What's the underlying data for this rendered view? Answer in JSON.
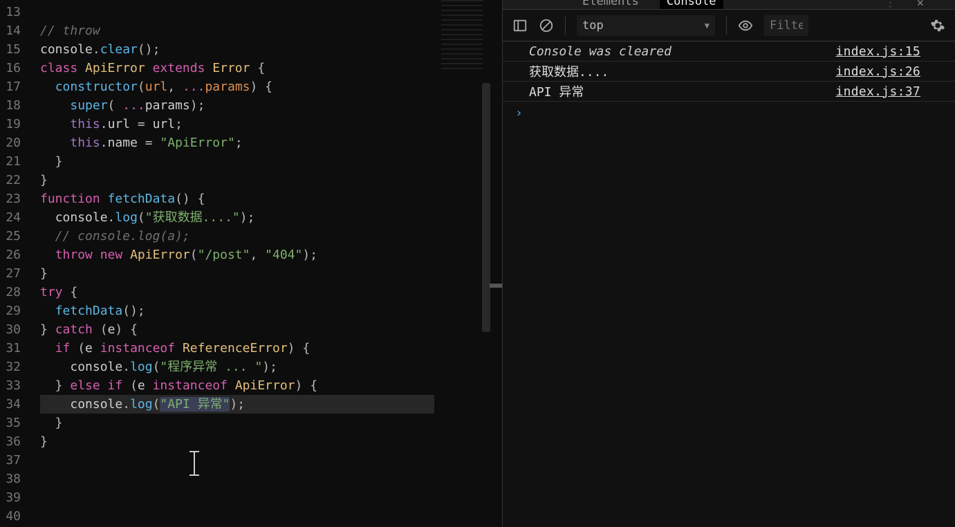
{
  "editor": {
    "first_line_number": 13,
    "lines": [
      {
        "n": 13,
        "tokens": [
          {
            "t": "  ",
            "c": "op"
          }
        ]
      },
      {
        "n": 14,
        "tokens": [
          {
            "t": "// throw",
            "c": "cm"
          }
        ]
      },
      {
        "n": 15,
        "tokens": [
          {
            "t": "console",
            "c": "ident"
          },
          {
            "t": ".",
            "c": "op"
          },
          {
            "t": "clear",
            "c": "fn"
          },
          {
            "t": "();",
            "c": "punc"
          }
        ]
      },
      {
        "n": 16,
        "tokens": [
          {
            "t": "",
            "c": "op"
          }
        ]
      },
      {
        "n": 17,
        "tokens": [
          {
            "t": "class ",
            "c": "kw"
          },
          {
            "t": "ApiError ",
            "c": "cls"
          },
          {
            "t": "extends ",
            "c": "kw"
          },
          {
            "t": "Error ",
            "c": "cls"
          },
          {
            "t": "{",
            "c": "punc"
          }
        ]
      },
      {
        "n": 18,
        "tokens": [
          {
            "t": "  ",
            "c": "op"
          },
          {
            "t": "constructor",
            "c": "fn"
          },
          {
            "t": "(",
            "c": "punc"
          },
          {
            "t": "url",
            "c": "prm"
          },
          {
            "t": ", ",
            "c": "punc"
          },
          {
            "t": "...",
            "c": "kw"
          },
          {
            "t": "params",
            "c": "prm"
          },
          {
            "t": ") {",
            "c": "punc"
          }
        ]
      },
      {
        "n": 19,
        "tokens": [
          {
            "t": "    ",
            "c": "op"
          },
          {
            "t": "super",
            "c": "fn"
          },
          {
            "t": "( ",
            "c": "punc"
          },
          {
            "t": "...",
            "c": "kw"
          },
          {
            "t": "params",
            "c": "ident"
          },
          {
            "t": ");",
            "c": "punc"
          }
        ]
      },
      {
        "n": 20,
        "tokens": [
          {
            "t": "    ",
            "c": "op"
          },
          {
            "t": "this",
            "c": "this"
          },
          {
            "t": ".",
            "c": "op"
          },
          {
            "t": "url",
            "c": "ident"
          },
          {
            "t": " = ",
            "c": "op"
          },
          {
            "t": "url",
            "c": "ident"
          },
          {
            "t": ";",
            "c": "punc"
          }
        ]
      },
      {
        "n": 21,
        "tokens": [
          {
            "t": "    ",
            "c": "op"
          },
          {
            "t": "this",
            "c": "this"
          },
          {
            "t": ".",
            "c": "op"
          },
          {
            "t": "name",
            "c": "ident"
          },
          {
            "t": " = ",
            "c": "op"
          },
          {
            "t": "\"ApiError\"",
            "c": "str"
          },
          {
            "t": ";",
            "c": "punc"
          }
        ]
      },
      {
        "n": 22,
        "tokens": [
          {
            "t": "  }",
            "c": "punc"
          }
        ]
      },
      {
        "n": 23,
        "tokens": [
          {
            "t": "}",
            "c": "punc"
          }
        ]
      },
      {
        "n": 24,
        "tokens": [
          {
            "t": "",
            "c": "op"
          }
        ]
      },
      {
        "n": 25,
        "tokens": [
          {
            "t": "function ",
            "c": "kw"
          },
          {
            "t": "fetchData",
            "c": "fn"
          },
          {
            "t": "() {",
            "c": "punc"
          }
        ]
      },
      {
        "n": 26,
        "tokens": [
          {
            "t": "  ",
            "c": "op"
          },
          {
            "t": "console",
            "c": "ident"
          },
          {
            "t": ".",
            "c": "op"
          },
          {
            "t": "log",
            "c": "fn"
          },
          {
            "t": "(",
            "c": "punc"
          },
          {
            "t": "\"获取数据....\"",
            "c": "str"
          },
          {
            "t": ");",
            "c": "punc"
          }
        ]
      },
      {
        "n": 27,
        "tokens": [
          {
            "t": "  ",
            "c": "op"
          },
          {
            "t": "// console.log(a);",
            "c": "cm"
          }
        ]
      },
      {
        "n": 28,
        "tokens": [
          {
            "t": "  ",
            "c": "op"
          },
          {
            "t": "throw ",
            "c": "kw"
          },
          {
            "t": "new ",
            "c": "kw"
          },
          {
            "t": "ApiError",
            "c": "cls"
          },
          {
            "t": "(",
            "c": "punc"
          },
          {
            "t": "\"/post\"",
            "c": "str"
          },
          {
            "t": ", ",
            "c": "punc"
          },
          {
            "t": "\"404\"",
            "c": "str"
          },
          {
            "t": ");",
            "c": "punc"
          }
        ]
      },
      {
        "n": 29,
        "tokens": [
          {
            "t": "}",
            "c": "punc"
          }
        ]
      },
      {
        "n": 30,
        "tokens": [
          {
            "t": "",
            "c": "op"
          }
        ]
      },
      {
        "n": 31,
        "tokens": [
          {
            "t": "try ",
            "c": "kw"
          },
          {
            "t": "{",
            "c": "punc"
          }
        ]
      },
      {
        "n": 32,
        "tokens": [
          {
            "t": "  ",
            "c": "op"
          },
          {
            "t": "fetchData",
            "c": "fn"
          },
          {
            "t": "();",
            "c": "punc"
          }
        ]
      },
      {
        "n": 33,
        "tokens": [
          {
            "t": "} ",
            "c": "punc"
          },
          {
            "t": "catch ",
            "c": "kw"
          },
          {
            "t": "(",
            "c": "punc"
          },
          {
            "t": "e",
            "c": "ident"
          },
          {
            "t": ") {",
            "c": "punc"
          }
        ]
      },
      {
        "n": 34,
        "tokens": [
          {
            "t": "  ",
            "c": "op"
          },
          {
            "t": "if ",
            "c": "kw"
          },
          {
            "t": "(",
            "c": "punc"
          },
          {
            "t": "e ",
            "c": "ident"
          },
          {
            "t": "instanceof ",
            "c": "kw"
          },
          {
            "t": "ReferenceError",
            "c": "cls"
          },
          {
            "t": ") {",
            "c": "punc"
          }
        ]
      },
      {
        "n": 35,
        "tokens": [
          {
            "t": "    ",
            "c": "op"
          },
          {
            "t": "console",
            "c": "ident"
          },
          {
            "t": ".",
            "c": "op"
          },
          {
            "t": "log",
            "c": "fn"
          },
          {
            "t": "(",
            "c": "punc"
          },
          {
            "t": "\"程序异常 ... \"",
            "c": "str"
          },
          {
            "t": ");",
            "c": "punc"
          }
        ]
      },
      {
        "n": 36,
        "tokens": [
          {
            "t": "  } ",
            "c": "punc"
          },
          {
            "t": "else ",
            "c": "kw"
          },
          {
            "t": "if ",
            "c": "kw"
          },
          {
            "t": "(",
            "c": "punc"
          },
          {
            "t": "e ",
            "c": "ident"
          },
          {
            "t": "instanceof ",
            "c": "kw"
          },
          {
            "t": "ApiError",
            "c": "cls"
          },
          {
            "t": ") {",
            "c": "punc"
          }
        ]
      },
      {
        "n": 37,
        "current": true,
        "tokens": [
          {
            "t": "    ",
            "c": "op"
          },
          {
            "t": "console",
            "c": "ident"
          },
          {
            "t": ".",
            "c": "op"
          },
          {
            "t": "log",
            "c": "fn"
          },
          {
            "t": "(",
            "c": "punc"
          },
          {
            "t": "\"API 异常\"",
            "c": "str",
            "sel": true
          },
          {
            "t": ");",
            "c": "punc"
          }
        ]
      },
      {
        "n": 38,
        "tokens": [
          {
            "t": "  }",
            "c": "punc"
          }
        ]
      },
      {
        "n": 39,
        "tokens": [
          {
            "t": "}",
            "c": "punc"
          }
        ]
      },
      {
        "n": 40,
        "tokens": [
          {
            "t": "",
            "c": "op"
          }
        ]
      }
    ]
  },
  "devtools": {
    "tabs": {
      "elements": "Elements",
      "console": "Console"
    },
    "context": "top",
    "filter_placeholder": "Filter",
    "logs": [
      {
        "msg": "Console was cleared",
        "italic": true,
        "src": "index.js:15"
      },
      {
        "msg": "获取数据....",
        "italic": false,
        "src": "index.js:26"
      },
      {
        "msg": "API 异常",
        "italic": false,
        "src": "index.js:37"
      }
    ],
    "prompt": "›"
  }
}
